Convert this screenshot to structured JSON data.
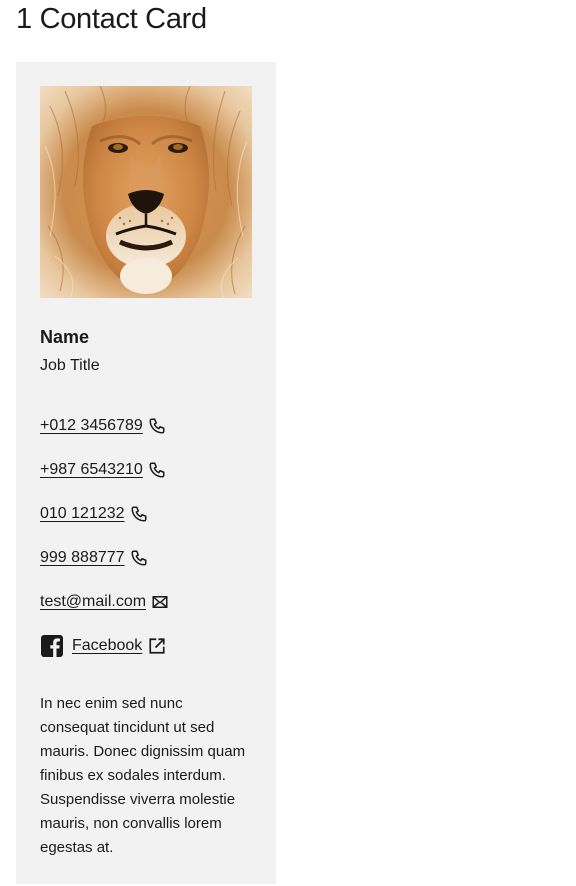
{
  "page": {
    "title": "1 Contact Card"
  },
  "card": {
    "photo_alt": "lion photo",
    "name": "Name",
    "job_title": "Job Title",
    "phones": [
      {
        "number": "+012 3456789",
        "icon": "phone-icon"
      },
      {
        "number": "+987 6543210",
        "icon": "phone-icon"
      },
      {
        "number": "010 121232",
        "icon": "phone-icon"
      },
      {
        "number": "999 888777",
        "icon": "phone-icon"
      }
    ],
    "email": {
      "address": "test@mail.com",
      "icon": "mail-icon"
    },
    "social": {
      "label": "Facebook",
      "icon": "facebook-icon",
      "trailing_icon": "external-link-icon"
    },
    "bio": "In nec enim sed nunc consequat tincidunt ut sed mauris. Donec dignissim quam finibus ex sodales interdum. Suspendisse viverra molestie mauris, non convallis lorem egestas at."
  },
  "colors": {
    "card_background": "#f2f2f2",
    "text": "#1a1a1a"
  }
}
